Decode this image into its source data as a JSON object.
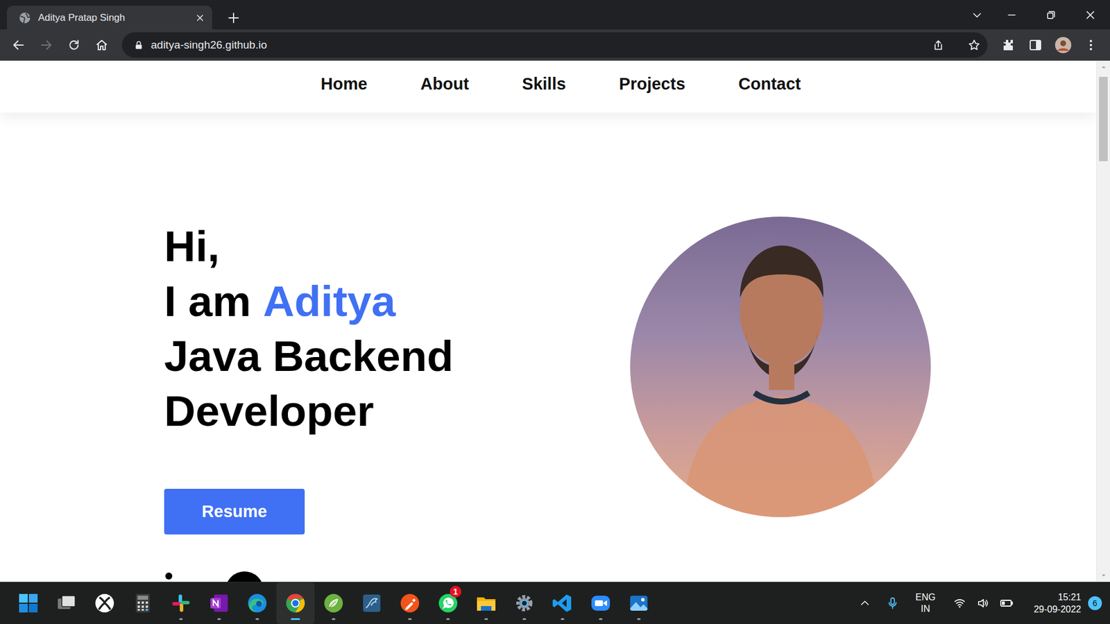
{
  "window": {
    "title": "Aditya Pratap Singh"
  },
  "browser": {
    "tabs": [
      {
        "label": "Aditya Pratap Singh",
        "selected": true
      }
    ],
    "back_disabled": false,
    "forward_disabled": true,
    "url": "aditya-singh26.github.io"
  },
  "page": {
    "nav": [
      {
        "label": "Home"
      },
      {
        "label": "About"
      },
      {
        "label": "Skills"
      },
      {
        "label": "Projects"
      },
      {
        "label": "Contact"
      }
    ],
    "greeting": "Hi,",
    "intro": "I am",
    "name": "Aditya",
    "role_lines": [
      "Java Backend",
      "Developer"
    ],
    "resume_button": "Resume"
  },
  "taskbar": {
    "apps": [
      {
        "kind": "start",
        "running": false,
        "active": false
      },
      {
        "kind": "taskview",
        "running": false,
        "active": false
      },
      {
        "kind": "xbox",
        "running": false,
        "active": false
      },
      {
        "kind": "calculator",
        "running": false,
        "active": false
      },
      {
        "kind": "slack",
        "running": true,
        "active": false
      },
      {
        "kind": "onenote",
        "running": true,
        "active": false
      },
      {
        "kind": "edge",
        "running": true,
        "active": false
      },
      {
        "kind": "chrome",
        "running": true,
        "active": true
      },
      {
        "kind": "spring",
        "running": true,
        "active": false
      },
      {
        "kind": "mysql",
        "running": false,
        "active": false
      },
      {
        "kind": "postman",
        "running": true,
        "active": false
      },
      {
        "kind": "whatsapp",
        "running": true,
        "active": false,
        "badge": "1"
      },
      {
        "kind": "explorer",
        "running": true,
        "active": false
      },
      {
        "kind": "settings",
        "running": true,
        "active": false
      },
      {
        "kind": "vscode",
        "running": true,
        "active": false
      },
      {
        "kind": "zoom",
        "running": true,
        "active": false
      },
      {
        "kind": "photos",
        "running": true,
        "active": false
      }
    ],
    "tray": {
      "language": "ENG",
      "region": "IN",
      "time": "15:21",
      "date": "29-09-2022",
      "notifications": "6"
    }
  }
}
